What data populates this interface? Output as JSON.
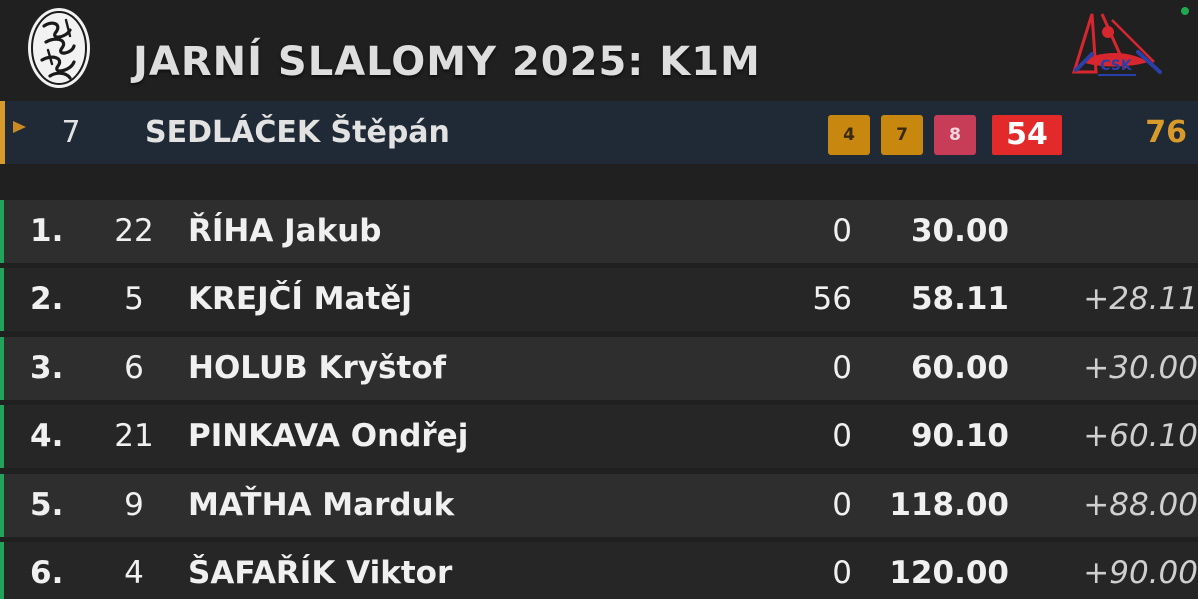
{
  "header": {
    "title": "JARNÍ SLALOMY 2025: K1M",
    "org_logo_text": "CSK"
  },
  "current": {
    "bib": "7",
    "name": "SEDLÁČEK Štěpán",
    "penalties": [
      {
        "value": "4",
        "kind": "gold"
      },
      {
        "value": "7",
        "kind": "gold"
      },
      {
        "value": "8",
        "kind": "pink"
      },
      {
        "value": "54",
        "kind": "red"
      }
    ],
    "total": "76"
  },
  "results": [
    {
      "rank": "1.",
      "bib": "22",
      "name": "ŘÍHA Jakub",
      "pen": "0",
      "time": "30.00",
      "diff": ""
    },
    {
      "rank": "2.",
      "bib": "5",
      "name": "KREJČÍ Matěj",
      "pen": "56",
      "time": "58.11",
      "diff": "+28.11"
    },
    {
      "rank": "3.",
      "bib": "6",
      "name": "HOLUB Kryštof",
      "pen": "0",
      "time": "60.00",
      "diff": "+30.00"
    },
    {
      "rank": "4.",
      "bib": "21",
      "name": "PINKAVA Ondřej",
      "pen": "0",
      "time": "90.10",
      "diff": "+60.10"
    },
    {
      "rank": "5.",
      "bib": "9",
      "name": "MAŤHA Marduk",
      "pen": "0",
      "time": "118.00",
      "diff": "+88.00"
    },
    {
      "rank": "6.",
      "bib": "4",
      "name": "ŠAFAŘÍK Viktor",
      "pen": "0",
      "time": "120.00",
      "diff": "+90.00"
    }
  ],
  "colors": {
    "background": "#202020",
    "accent_gold": "#d89a2a",
    "penalty_gold": "#c8870e",
    "penalty_pink": "#c73d57",
    "penalty_red": "#e32a2a",
    "row_border_green": "#23a25a",
    "status_dot": "#1fa84f"
  },
  "icons": {
    "left_logo": "calligraphy-emblem-icon",
    "right_logo": "csk-canoe-logo-icon",
    "current_marker": "play-arrow-icon",
    "status": "status-dot-icon"
  }
}
